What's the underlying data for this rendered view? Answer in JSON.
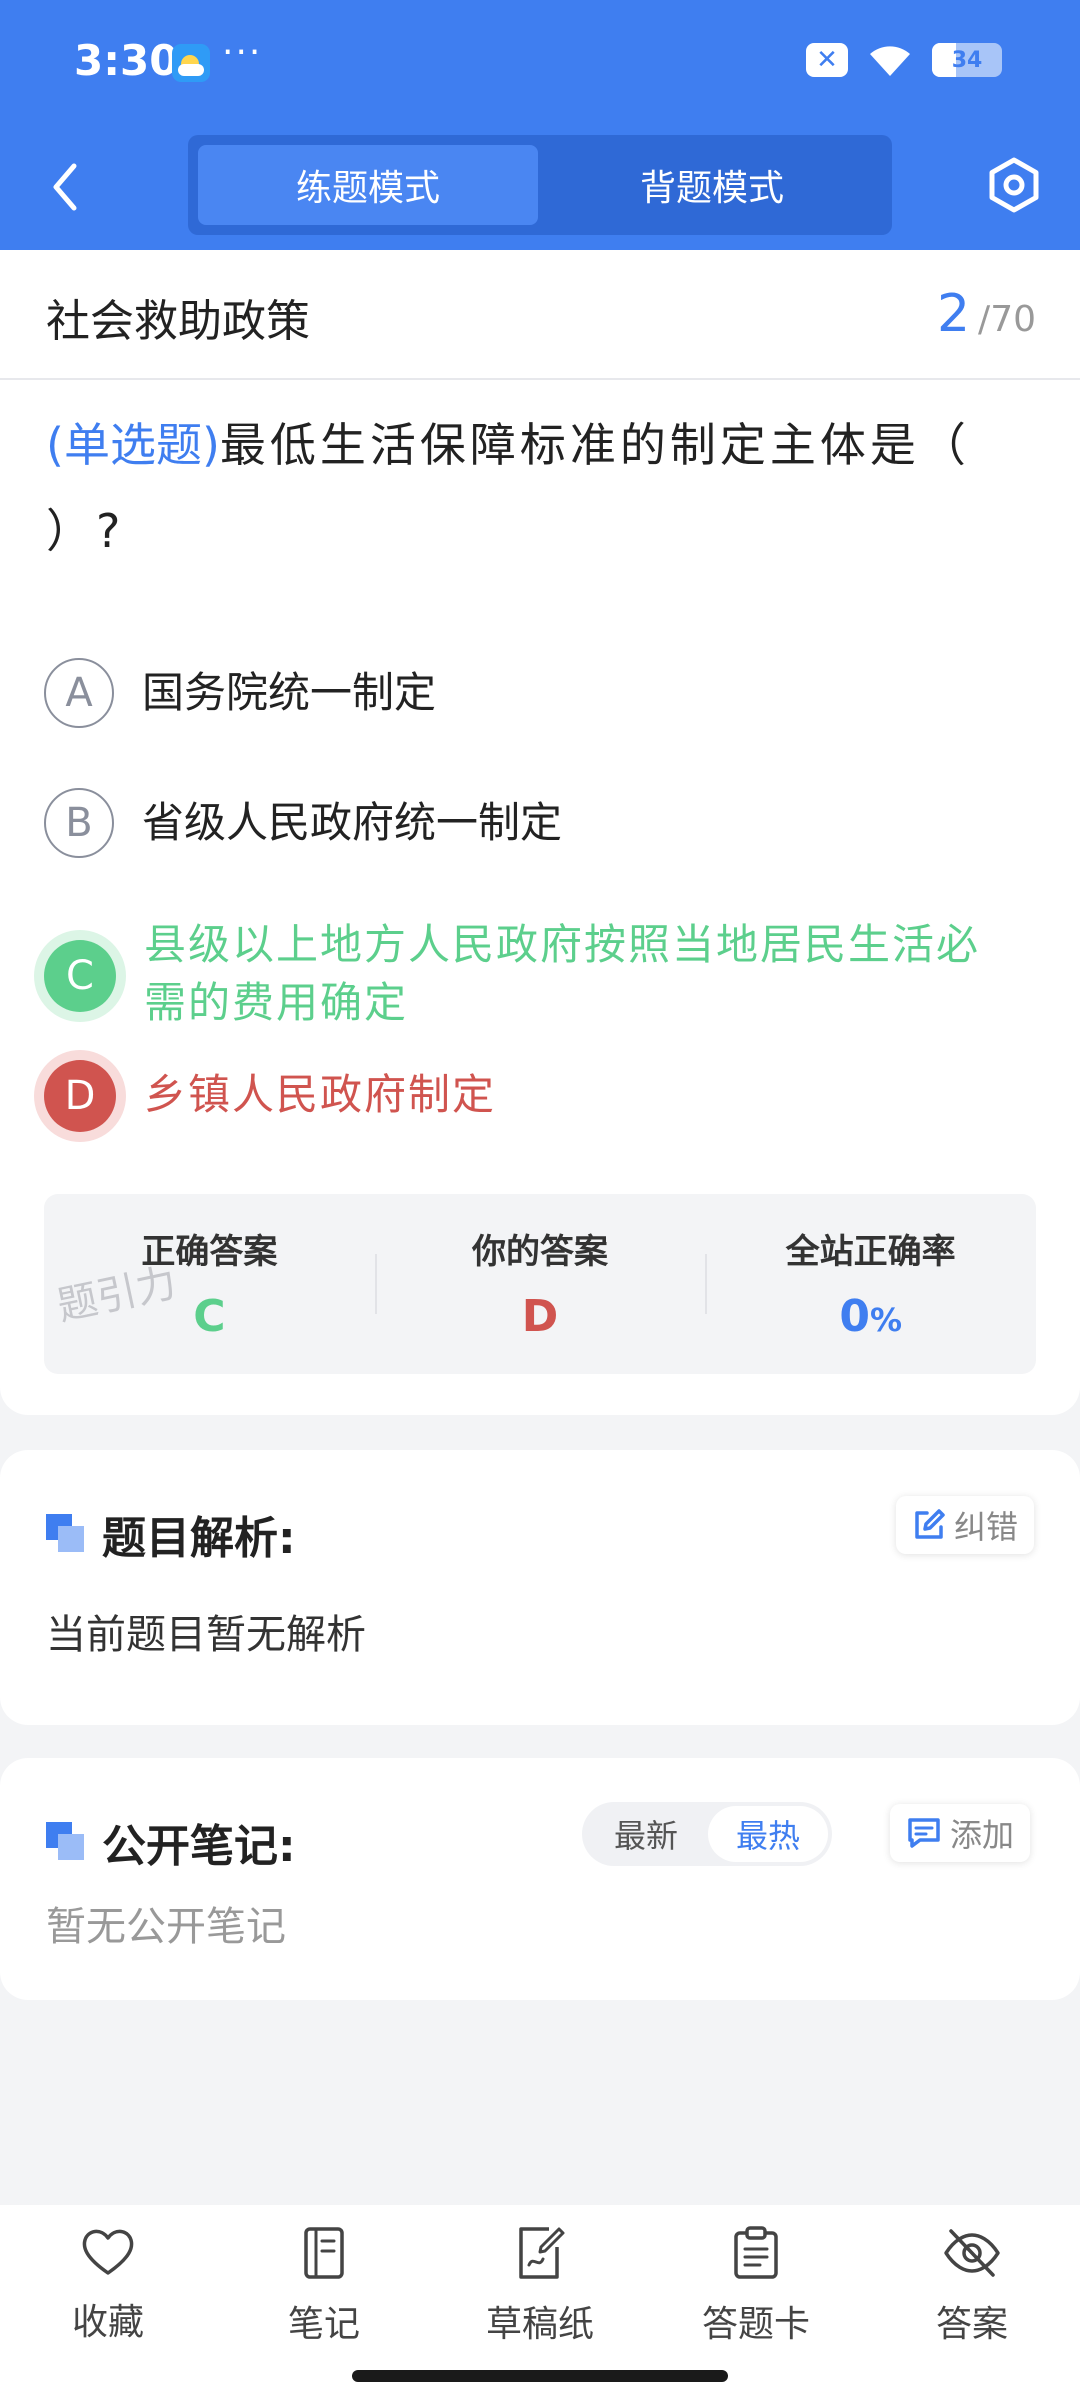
{
  "status_bar": {
    "time": "3:30",
    "dots": "···",
    "sim_badge": "✕",
    "battery": "34"
  },
  "nav": {
    "tab_practice": "练题模式",
    "tab_review": "背题模式"
  },
  "chapter": {
    "title": "社会救助政策",
    "current": "2",
    "separator": "/",
    "total": "70"
  },
  "question": {
    "type": "(单选题)",
    "text": "最低生活保障标准的制定主体是（ ）?"
  },
  "options": [
    {
      "letter": "A",
      "text": "国务院统一制定"
    },
    {
      "letter": "B",
      "text": "省级人民政府统一制定"
    },
    {
      "letter": "C",
      "text": "县级以上地方人民政府按照当地居民生活必需的费用确定"
    },
    {
      "letter": "D",
      "text": "乡镇人民政府制定"
    }
  ],
  "answer_summary": {
    "correct_label": "正确答案",
    "correct_value": "C",
    "yours_label": "你的答案",
    "yours_value": "D",
    "rate_label": "全站正确率",
    "rate_value": "0",
    "rate_unit": "%",
    "watermark": "题引力"
  },
  "analysis": {
    "title": "题目解析:",
    "report_label": "纠错",
    "text": "当前题目暂无解析"
  },
  "notes": {
    "title": "公开笔记:",
    "sort_latest": "最新",
    "sort_hot": "最热",
    "add_label": "添加",
    "empty_text": "暂无公开笔记"
  },
  "toolbar": {
    "favorite": "收藏",
    "notes": "笔记",
    "scratch": "草稿纸",
    "answer_sheet": "答题卡",
    "answer": "答案"
  },
  "colors": {
    "brand": "#3f7ef0",
    "correct": "#5ccf8c",
    "wrong": "#d0544f"
  }
}
